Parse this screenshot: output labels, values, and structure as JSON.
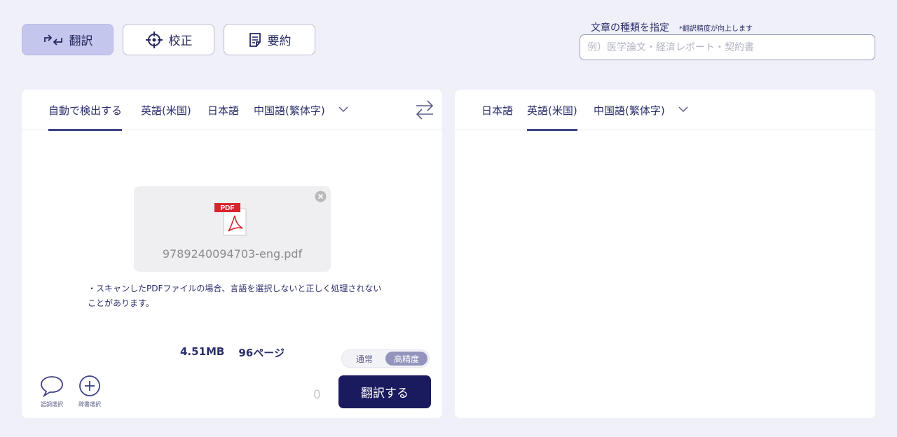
{
  "modes": {
    "translate": "翻訳",
    "proofread": "校正",
    "summary": "要約"
  },
  "doc_type": {
    "label": "文章の種類を指定",
    "note": "*翻訳精度が向上します",
    "placeholder": "例）医学論文・経済レポート・契約書"
  },
  "source": {
    "tabs": [
      "自動で検出する",
      "英語(米国)",
      "日本語",
      "中国語(繁体字)"
    ],
    "active_tab": 0
  },
  "target": {
    "tabs": [
      "日本語",
      "英語(米国)",
      "中国語(繁体字)"
    ],
    "active_tab": 1
  },
  "file": {
    "icon_label": "PDF",
    "name": "9789240094703-eng.pdf",
    "size": "4.51MB",
    "pages": "96ページ"
  },
  "notice": "・スキャンしたPDFファイルの場合、言語を選択しないと正しく処理されないことがあります。",
  "precision": {
    "options": [
      "通常",
      "高精度"
    ],
    "selected": "高精度"
  },
  "tools": {
    "tone": "語調選択",
    "dictionary": "辞書選択"
  },
  "char_count": "0",
  "translate_button": "翻訳する",
  "colors": {
    "accent": "#3e4287",
    "primary_button": "#1a1a5e",
    "active_mode_bg": "#c4c6ee",
    "page_bg": "#eff0f8"
  }
}
